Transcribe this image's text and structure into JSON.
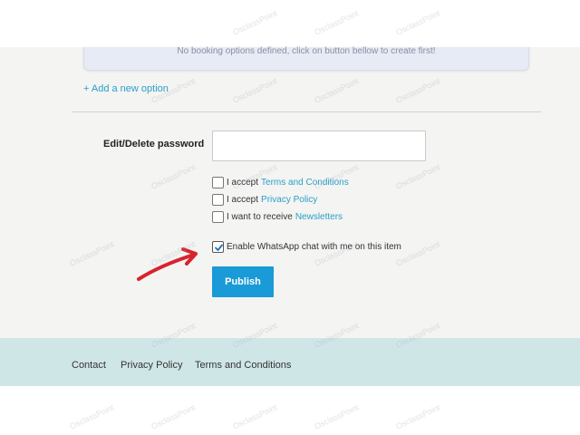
{
  "booking": {
    "notice": "No booking options defined, click on button bellow to create first!",
    "add_option": "+ Add a new option"
  },
  "form": {
    "password_label": "Edit/Delete password",
    "password_value": "",
    "checks": [
      {
        "prefix": "I accept",
        "link": "Terms and Conditions",
        "checked": false
      },
      {
        "prefix": "I accept",
        "link": "Privacy Policy",
        "checked": false
      },
      {
        "prefix": "I want to receive",
        "link": "Newsletters",
        "checked": false
      },
      {
        "prefix": "Enable WhatsApp chat with me on this item",
        "link": "",
        "checked": true
      }
    ],
    "publish_label": "Publish"
  },
  "footer": {
    "links": [
      "Contact",
      "Privacy Policy",
      "Terms and Conditions"
    ]
  },
  "watermark": "OsclassPoint",
  "colors": {
    "accent": "#1a9ad6",
    "link": "#2a9fc9",
    "arrow": "#d9232d",
    "footer_bg": "#cfe6e7"
  }
}
